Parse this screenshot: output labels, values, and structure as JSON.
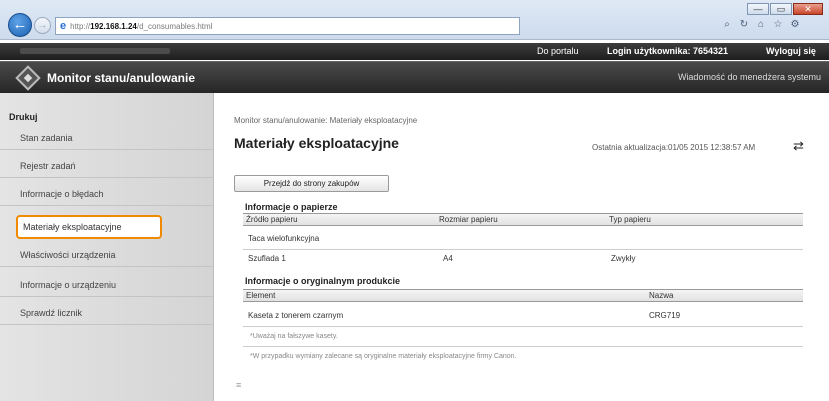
{
  "browser": {
    "url_prefix": "http://",
    "url_host": "192.168.1.24",
    "url_path": "/d_consumables.html",
    "minimize": "—",
    "maximize": "▭",
    "close": "✕"
  },
  "topbar": {
    "portal_link": "Do portalu",
    "login_label": "Login użytkownika: 7654321",
    "logout_link": "Wyloguj się"
  },
  "header": {
    "title": "Monitor stanu/anulowanie",
    "contact": "Wiadomość do menedżera systemu"
  },
  "sidebar": {
    "section": "Drukuj",
    "items": [
      {
        "label": "Stan zadania"
      },
      {
        "label": "Rejestr zadań"
      },
      {
        "label": "Informacje o błędach"
      },
      {
        "label": "Materiały eksploatacyjne"
      },
      {
        "label": "Właściwości urządzenia"
      },
      {
        "label": "Informacje o urządzeniu"
      },
      {
        "label": "Sprawdź licznik"
      }
    ]
  },
  "main": {
    "breadcrumb": "Monitor stanu/anulowanie: Materiały eksploatacyjne",
    "title": "Materiały eksploatacyjne",
    "last_update": "Ostatnia aktualizacja:01/05 2015 12:38:57 AM",
    "shop_button": "Przejdź do strony zakupów",
    "paper": {
      "title": "Informacje o papierze",
      "columns": [
        "Źródło papieru",
        "Rozmiar papieru",
        "Typ papieru"
      ],
      "rows": [
        [
          "Taca wielofunkcyjna",
          "",
          ""
        ],
        [
          "Szuflada 1",
          "A4",
          "Zwykły"
        ]
      ]
    },
    "products": {
      "title": "Informacje o oryginalnym produkcie",
      "columns": [
        "Element",
        "Nazwa"
      ],
      "rows": [
        [
          "Kaseta z tonerem czarnym",
          "CRG719"
        ]
      ]
    },
    "footnote_1": "*Uważaj na fałszywe kasety.",
    "footnote_2": "*W przypadku wymiany zalecane są oryginalne materiały eksploatacyjne firmy Canon."
  }
}
